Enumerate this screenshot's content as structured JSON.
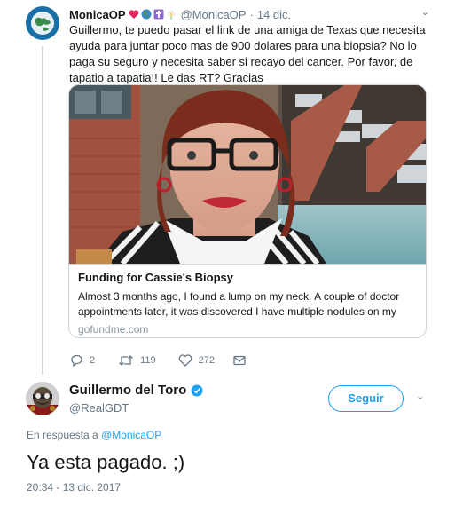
{
  "tweet1": {
    "display_name": "MonicaOP",
    "emoji_icons": [
      "heart-emoji",
      "globe-emoji",
      "cross-emoji",
      "flower-emoji"
    ],
    "handle": "@MonicaOP",
    "separator": "·",
    "date": "14 dic.",
    "text": "Guillermo, te puedo pasar el link de una amiga de Texas que necesita ayuda para juntar poco mas de 900 dolares para una biopsia? No lo paga su seguro y necesita saber si recayo del cancer. Por favor, de tapatio a tapatia!! Le das RT? Gracias",
    "card": {
      "title": "Funding for Cassie's Biopsy",
      "description": "Almost 3 months ago, I found a lump on my neck. A couple of doctor appointments later, it was discovered I have multiple nodules on my thyroid, on...",
      "domain": "gofundme.com"
    },
    "actions": {
      "replies": "2",
      "retweets": "119",
      "likes": "272"
    }
  },
  "tweet2": {
    "display_name": "Guillermo del Toro",
    "verified": true,
    "handle": "@RealGDT",
    "follow_label": "Seguir",
    "reply_prefix": "En respuesta a",
    "reply_handle": "@MonicaOP",
    "text": "Ya esta pagado.  ;)",
    "timestamp": "20:34 - 13 dic. 2017"
  },
  "colors": {
    "accent": "#1da1f2",
    "text": "#14171a",
    "secondary": "#657786",
    "border": "#ccd6dd",
    "verified": "#1da1f2"
  }
}
